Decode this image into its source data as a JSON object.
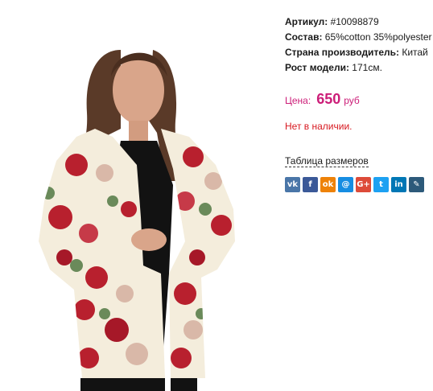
{
  "product": {
    "sku_label": "Артикул:",
    "sku_value": "#10098879",
    "composition_label": "Состав:",
    "composition_value": "65%cotton 35%polyester",
    "country_label": "Страна производитель:",
    "country_value": "Китай",
    "height_label": "Рост модели:",
    "height_value": "171см."
  },
  "price": {
    "label": "Цена:",
    "value": "650",
    "currency": "руб",
    "color": "#cc1d78"
  },
  "stock_status": {
    "text": "Нет в наличии.",
    "color": "#d71920"
  },
  "size_table_link": "Таблица размеров",
  "share_buttons": [
    {
      "name": "vkontakte-icon",
      "glyph": "vk",
      "color": "#4a76a8"
    },
    {
      "name": "facebook-icon",
      "glyph": "f",
      "color": "#3b5998"
    },
    {
      "name": "odnoklassniki-icon",
      "glyph": "ok",
      "color": "#ee8208"
    },
    {
      "name": "moimir-icon",
      "glyph": "@",
      "color": "#168de2"
    },
    {
      "name": "google-plus-icon",
      "glyph": "G+",
      "color": "#dd4b39"
    },
    {
      "name": "twitter-icon",
      "glyph": "t",
      "color": "#1da1f2"
    },
    {
      "name": "linkedin-icon",
      "glyph": "in",
      "color": "#0077b5"
    },
    {
      "name": "livejournal-icon",
      "glyph": "✎",
      "color": "#2d5a7a"
    }
  ]
}
